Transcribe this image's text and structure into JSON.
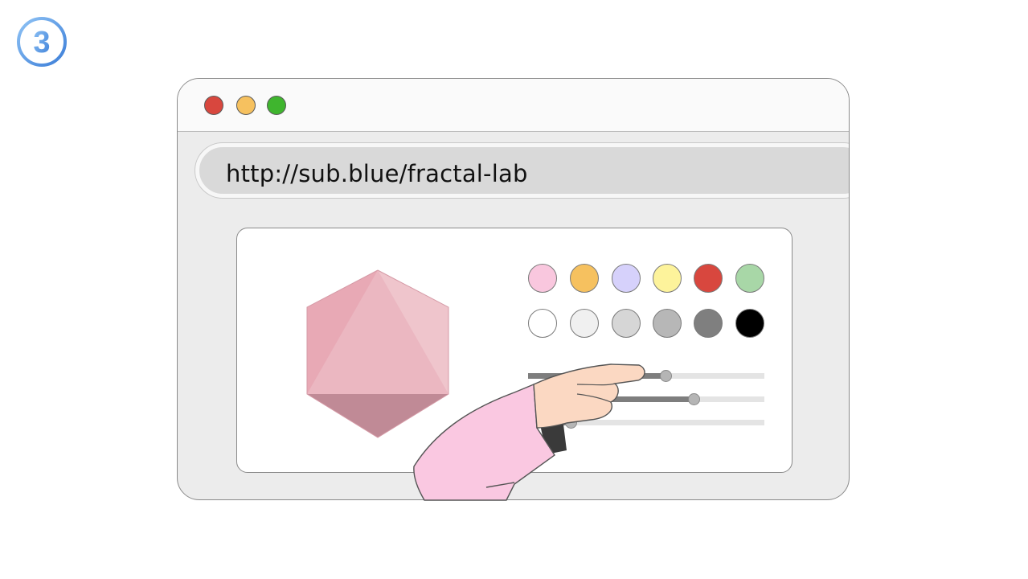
{
  "step": {
    "label": "3"
  },
  "browser": {
    "window_controls": [
      "close",
      "minimize",
      "maximize"
    ],
    "url": "http://sub.blue/fractal-lab"
  },
  "palette": {
    "colors_row1": [
      "#f9c7de",
      "#f6c15f",
      "#d6d1fb",
      "#fdf39b",
      "#d8473e",
      "#a8d7a7"
    ],
    "colors_row2": [
      "#ffffff",
      "#f0f0f0",
      "#d6d6d6",
      "#b7b7b7",
      "#7f7f7f",
      "#000000"
    ]
  },
  "sliders": [
    {
      "name": "slider-1",
      "value": 0.58
    },
    {
      "name": "slider-2",
      "value": 0.7
    },
    {
      "name": "slider-3",
      "value": 0.18
    }
  ],
  "shape": {
    "icon": "octahedron-icon",
    "colors": [
      "#e8a9b5",
      "#efc5cc",
      "#c08a96"
    ]
  }
}
